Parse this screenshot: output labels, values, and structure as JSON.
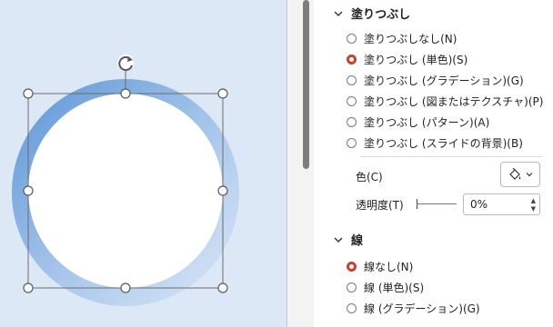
{
  "colors": {
    "accent": "#c8432c",
    "canvas": "#dce8f6",
    "ring_start": "#6a9fd9",
    "ring_end": "#dbe8f6"
  },
  "fill_section": {
    "title": "塗りつぶし",
    "options": [
      {
        "label": "塗りつぶしなし(N)",
        "selected": false
      },
      {
        "label": "塗りつぶし (単色)(S)",
        "selected": true
      },
      {
        "label": "塗りつぶし (グラデーション)(G)",
        "selected": false
      },
      {
        "label": "塗りつぶし (図またはテクスチャ)(P)",
        "selected": false
      },
      {
        "label": "塗りつぶし (パターン)(A)",
        "selected": false
      },
      {
        "label": "塗りつぶし (スライドの背景)(B)",
        "selected": false
      }
    ],
    "color_label": "色(C)",
    "color_icon": "paint-bucket-icon",
    "transparency_label": "透明度(T)",
    "transparency_value": "0%"
  },
  "line_section": {
    "title": "線",
    "options": [
      {
        "label": "線なし(N)",
        "selected": true
      },
      {
        "label": "線 (単色)(S)",
        "selected": false
      },
      {
        "label": "線 (グラデーション)(G)",
        "selected": false
      }
    ]
  }
}
